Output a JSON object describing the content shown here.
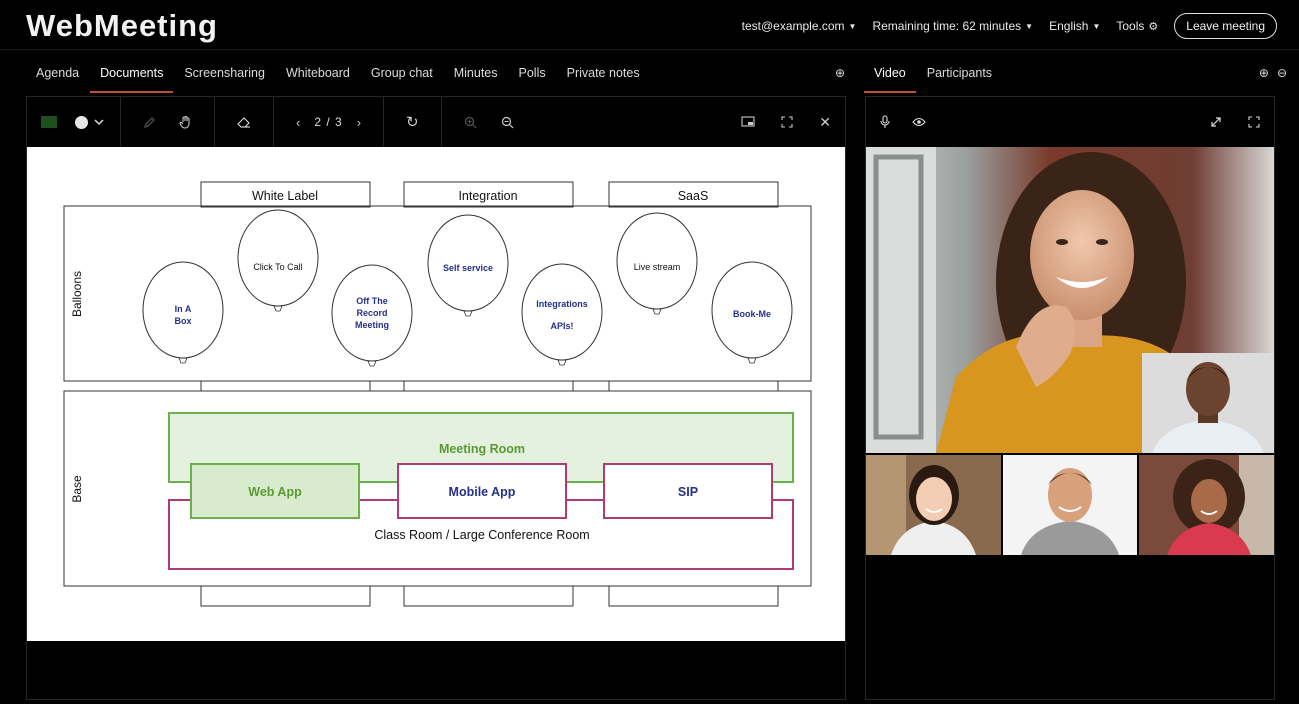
{
  "app": {
    "logo": "WebMeeting",
    "user_email": "test@example.com",
    "remaining_time": "Remaining time: 62 minutes",
    "language": "English",
    "tools": "Tools",
    "leave_label": "Leave meeting"
  },
  "left_tabs": [
    "Agenda",
    "Documents",
    "Screensharing",
    "Whiteboard",
    "Group chat",
    "Minutes",
    "Polls",
    "Private notes"
  ],
  "left_active_tab": "Documents",
  "right_tabs": [
    "Video",
    "Participants"
  ],
  "right_active_tab": "Video",
  "doc_toolbar": {
    "page_indicator": "2 / 3",
    "pen_color": "#1f4f1a"
  },
  "diagram": {
    "top_labels": [
      "White Label",
      "Integration",
      "SaaS"
    ],
    "section_balloons": "Balloons",
    "section_base": "Base",
    "balloons": [
      "In A Box",
      "Click To Call",
      "Off The Record Meeting",
      "Self service",
      "Integrations APIs!",
      "Live stream",
      "Book-Me"
    ],
    "meeting_room": "Meeting Room",
    "web_app": "Web App",
    "mobile_app": "Mobile App",
    "sip": "SIP",
    "class_room": "Class Room /  Large Conference Room"
  },
  "colors": {
    "accent": "#c4502e",
    "green": "#6ab04c",
    "magenta": "#b03a73",
    "balloon_text": "#23318a"
  }
}
